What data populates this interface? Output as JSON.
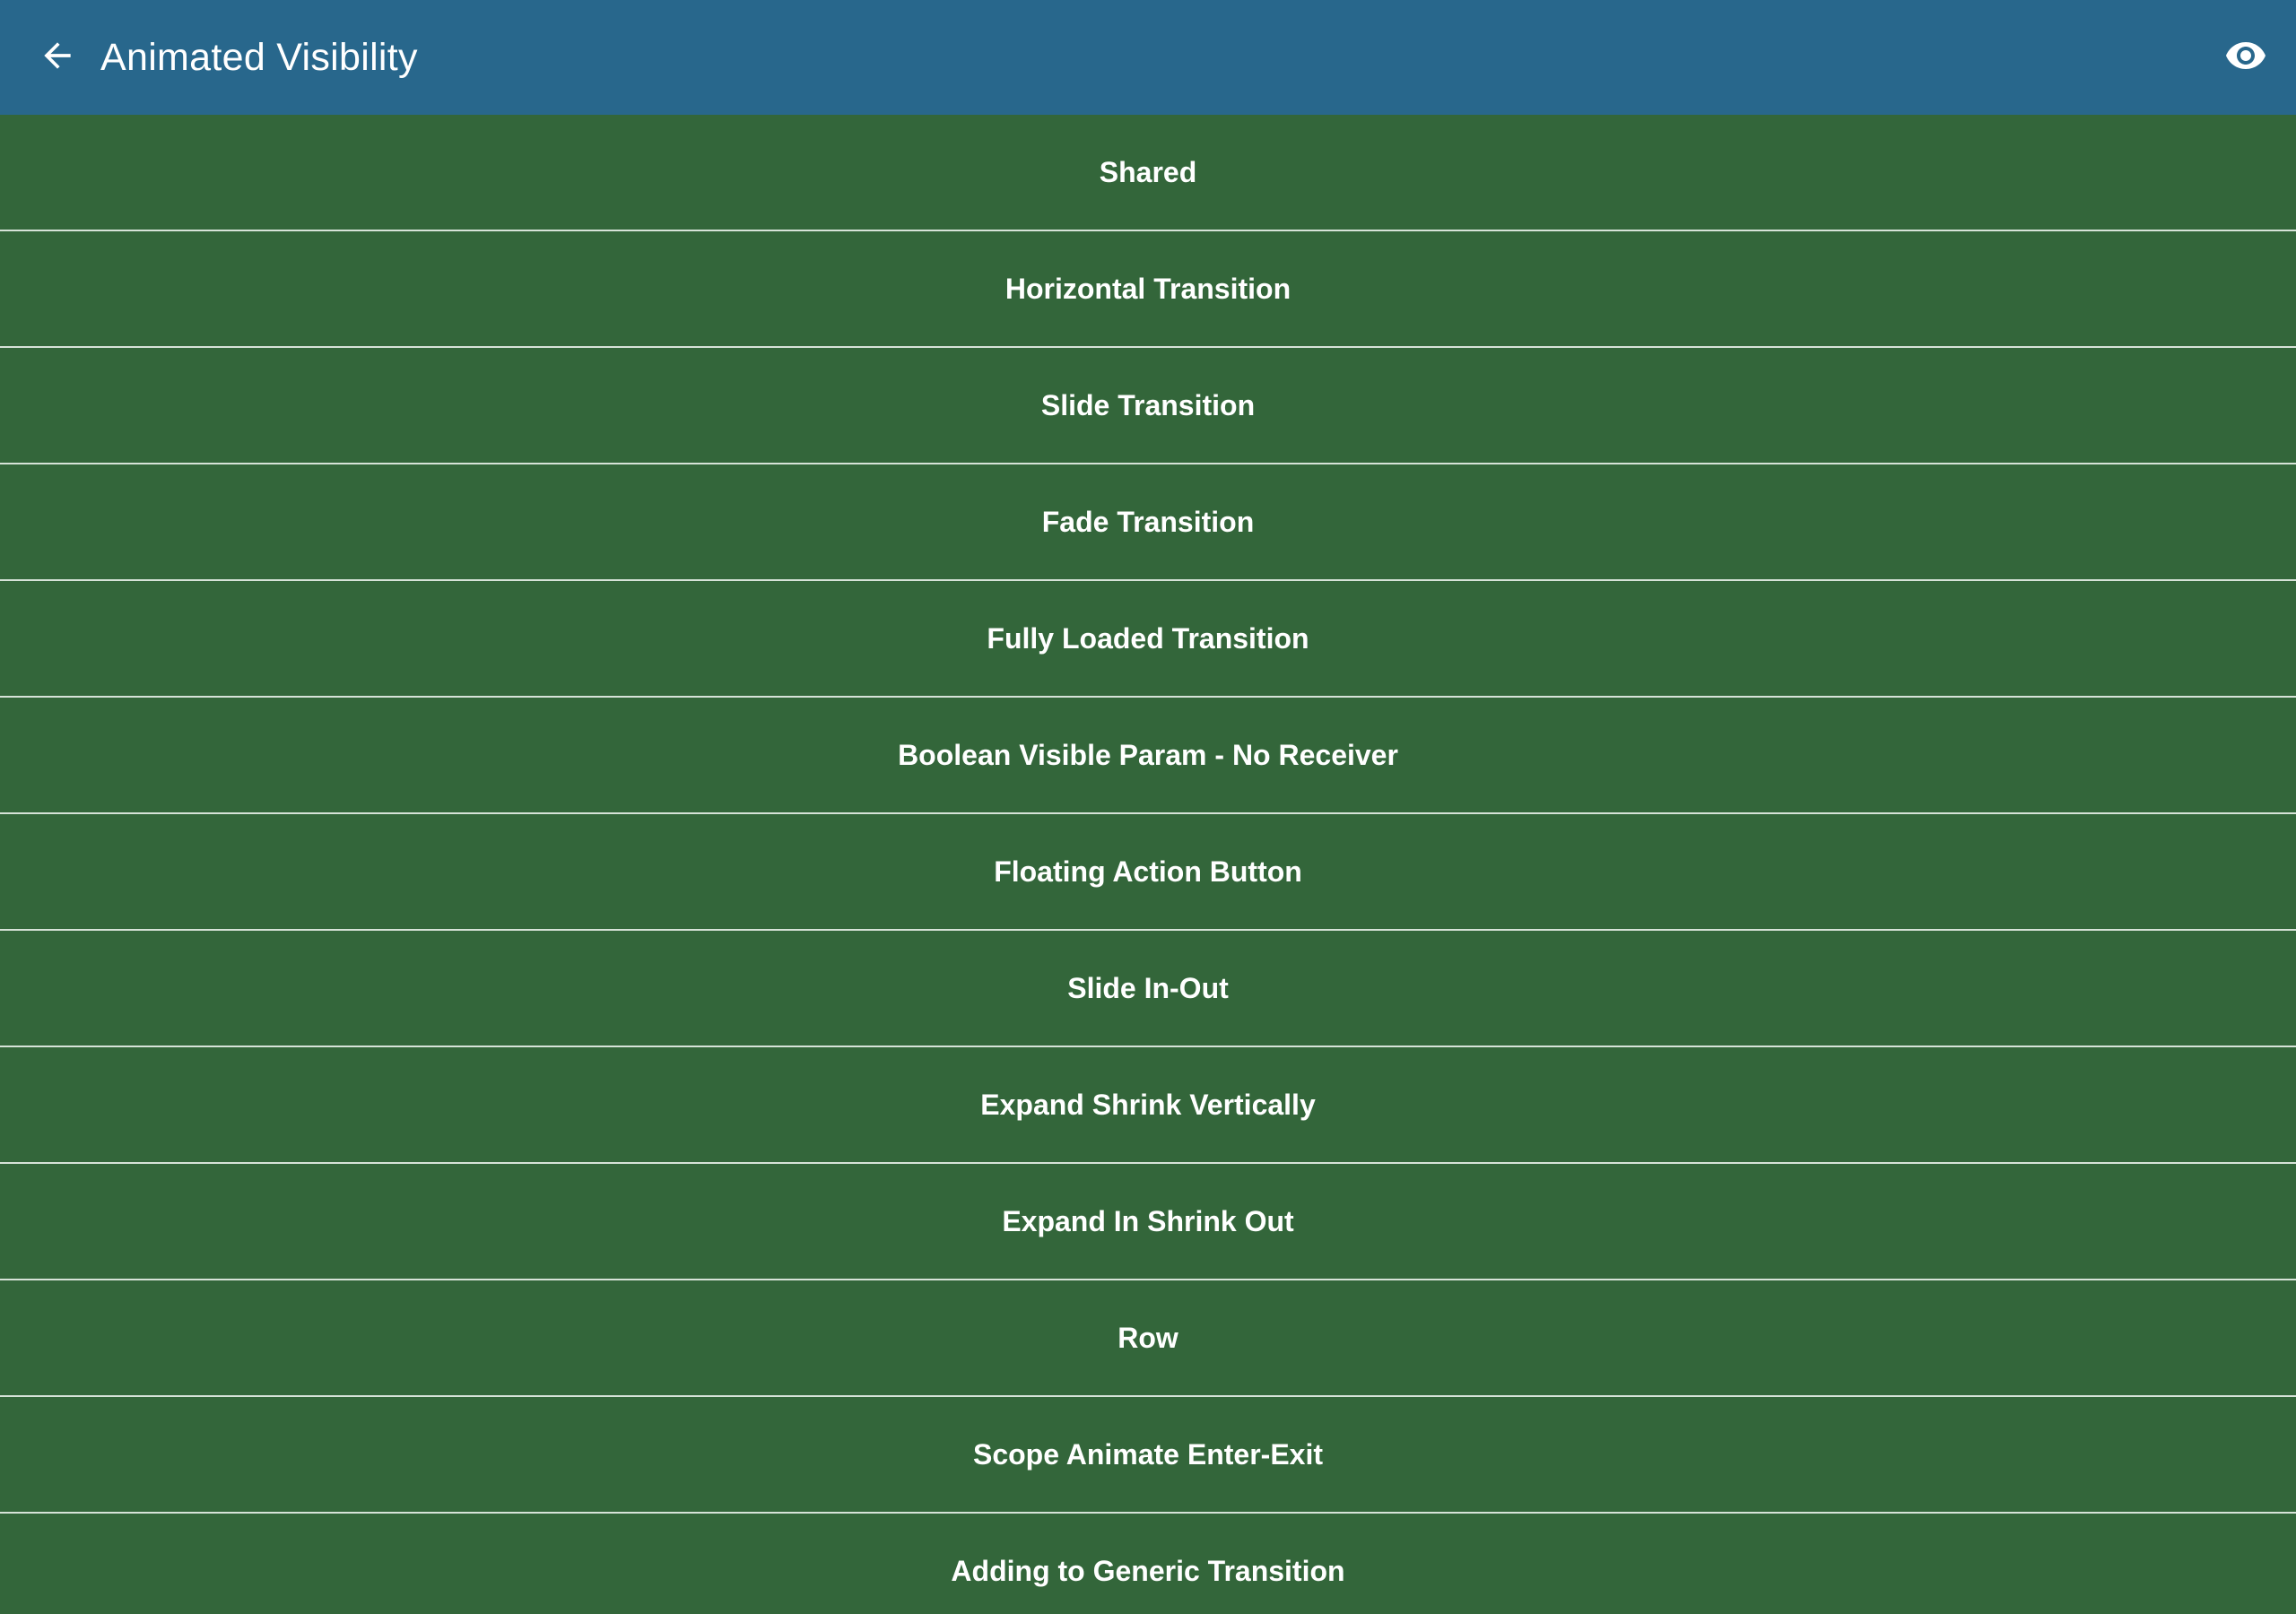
{
  "app_bar": {
    "title": "Animated Visibility",
    "back_icon": "arrow-back-icon",
    "action_icon": "eye-icon"
  },
  "colors": {
    "app_bar": "#28678c",
    "list_background": "#33663a",
    "divider": "#d7e3d8",
    "text": "#ffffff"
  },
  "items": [
    {
      "label": "Shared"
    },
    {
      "label": "Horizontal Transition"
    },
    {
      "label": "Slide Transition"
    },
    {
      "label": "Fade Transition"
    },
    {
      "label": "Fully Loaded Transition"
    },
    {
      "label": "Boolean Visible Param - No Receiver"
    },
    {
      "label": "Floating Action Button"
    },
    {
      "label": "Slide In-Out"
    },
    {
      "label": "Expand Shrink Vertically"
    },
    {
      "label": "Expand In Shrink Out"
    },
    {
      "label": "Row"
    },
    {
      "label": "Scope Animate Enter-Exit"
    },
    {
      "label": "Adding to Generic Transition"
    }
  ]
}
